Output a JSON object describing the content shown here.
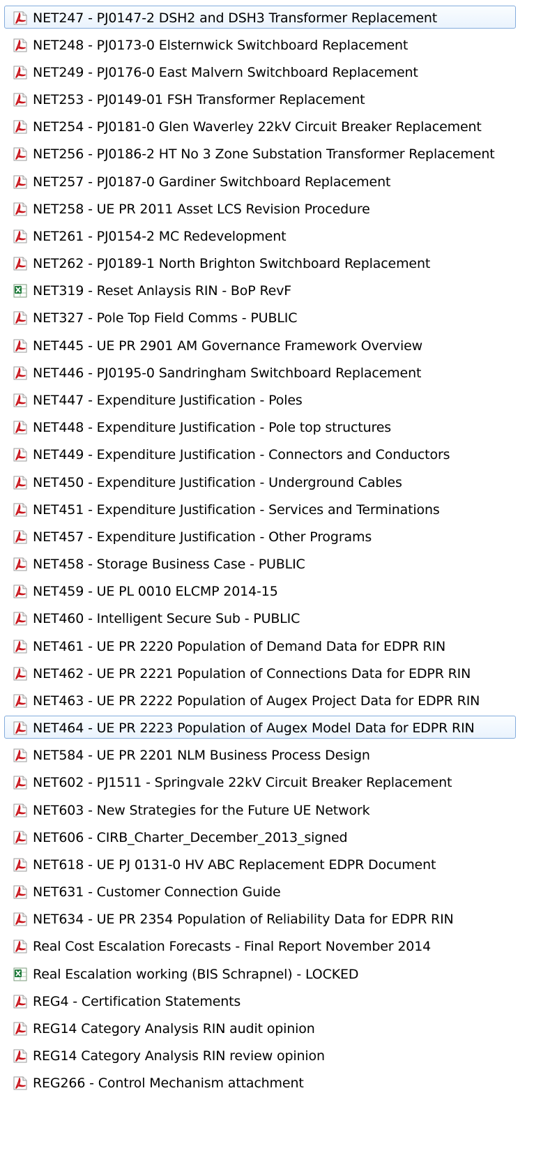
{
  "colors": {
    "pdf_icon": "#c8161d",
    "excel_icon": "#1d7a3a",
    "highlight_border": "#84acdd",
    "highlight_fill": "#eaf3fd"
  },
  "files": [
    {
      "name": "NET247 - PJ0147-2 DSH2 and DSH3 Transformer Replacement",
      "icon": "pdf-icon",
      "highlighted": true
    },
    {
      "name": "NET248 - PJ0173-0 Elsternwick Switchboard Replacement",
      "icon": "pdf-icon",
      "highlighted": false
    },
    {
      "name": "NET249 - PJ0176-0 East Malvern Switchboard Replacement",
      "icon": "pdf-icon",
      "highlighted": false
    },
    {
      "name": "NET253 - PJ0149-01 FSH Transformer Replacement",
      "icon": "pdf-icon",
      "highlighted": false
    },
    {
      "name": "NET254 - PJ0181-0 Glen Waverley 22kV Circuit Breaker Replacement",
      "icon": "pdf-icon",
      "highlighted": false
    },
    {
      "name": "NET256 - PJ0186-2 HT No 3 Zone Substation Transformer Replacement",
      "icon": "pdf-icon",
      "highlighted": false
    },
    {
      "name": "NET257 - PJ0187-0 Gardiner Switchboard Replacement",
      "icon": "pdf-icon",
      "highlighted": false
    },
    {
      "name": "NET258 - UE PR 2011 Asset LCS Revision Procedure",
      "icon": "pdf-icon",
      "highlighted": false
    },
    {
      "name": "NET261 - PJ0154-2 MC Redevelopment",
      "icon": "pdf-icon",
      "highlighted": false
    },
    {
      "name": "NET262 - PJ0189-1 North Brighton Switchboard Replacement",
      "icon": "pdf-icon",
      "highlighted": false
    },
    {
      "name": "NET319 - Reset Anlaysis RIN - BoP RevF",
      "icon": "excel-icon",
      "highlighted": false
    },
    {
      "name": "NET327 - Pole Top Field Comms - PUBLIC",
      "icon": "pdf-icon",
      "highlighted": false
    },
    {
      "name": "NET445 - UE PR 2901 AM Governance Framework Overview",
      "icon": "pdf-icon",
      "highlighted": false
    },
    {
      "name": "NET446 - PJ0195-0 Sandringham Switchboard Replacement",
      "icon": "pdf-icon",
      "highlighted": false
    },
    {
      "name": "NET447 - Expenditure Justification - Poles",
      "icon": "pdf-icon",
      "highlighted": false
    },
    {
      "name": "NET448 - Expenditure Justification - Pole top structures",
      "icon": "pdf-icon",
      "highlighted": false
    },
    {
      "name": "NET449 - Expenditure Justification - Connectors and Conductors",
      "icon": "pdf-icon",
      "highlighted": false
    },
    {
      "name": "NET450 - Expenditure Justification - Underground Cables",
      "icon": "pdf-icon",
      "highlighted": false
    },
    {
      "name": "NET451 - Expenditure Justification - Services and Terminations",
      "icon": "pdf-icon",
      "highlighted": false
    },
    {
      "name": "NET457 - Expenditure Justification - Other Programs",
      "icon": "pdf-icon",
      "highlighted": false
    },
    {
      "name": "NET458 - Storage Business Case - PUBLIC",
      "icon": "pdf-icon",
      "highlighted": false
    },
    {
      "name": "NET459 - UE PL 0010 ELCMP 2014-15",
      "icon": "pdf-icon",
      "highlighted": false
    },
    {
      "name": "NET460 - Intelligent Secure Sub - PUBLIC",
      "icon": "pdf-icon",
      "highlighted": false
    },
    {
      "name": "NET461 - UE PR 2220 Population of Demand Data for EDPR RIN",
      "icon": "pdf-icon",
      "highlighted": false
    },
    {
      "name": "NET462 - UE PR 2221 Population of Connections Data for EDPR RIN",
      "icon": "pdf-icon",
      "highlighted": false
    },
    {
      "name": "NET463 - UE PR 2222 Population of Augex Project Data for EDPR RIN",
      "icon": "pdf-icon",
      "highlighted": false
    },
    {
      "name": "NET464 - UE PR 2223 Population of Augex Model Data for EDPR RIN",
      "icon": "pdf-icon",
      "highlighted": true
    },
    {
      "name": "NET584 - UE PR 2201 NLM Business Process Design",
      "icon": "pdf-icon",
      "highlighted": false
    },
    {
      "name": "NET602 - PJ1511 - Springvale 22kV Circuit Breaker Replacement",
      "icon": "pdf-icon",
      "highlighted": false
    },
    {
      "name": "NET603 - New Strategies for the Future UE Network",
      "icon": "pdf-icon",
      "highlighted": false
    },
    {
      "name": "NET606 - CIRB_Charter_December_2013_signed",
      "icon": "pdf-icon",
      "highlighted": false
    },
    {
      "name": "NET618 - UE PJ 0131-0 HV ABC Replacement EDPR Document",
      "icon": "pdf-icon",
      "highlighted": false
    },
    {
      "name": "NET631 - Customer Connection Guide",
      "icon": "pdf-icon",
      "highlighted": false
    },
    {
      "name": "NET634 - UE PR 2354 Population of Reliability Data for EDPR RIN",
      "icon": "pdf-icon",
      "highlighted": false
    },
    {
      "name": "Real Cost Escalation Forecasts - Final Report November 2014",
      "icon": "pdf-icon",
      "highlighted": false
    },
    {
      "name": "Real Escalation working (BIS Schrapnel) - LOCKED",
      "icon": "excel-icon",
      "highlighted": false
    },
    {
      "name": "REG4 - Certification Statements",
      "icon": "pdf-icon",
      "highlighted": false
    },
    {
      "name": "REG14 Category Analysis RIN audit opinion",
      "icon": "pdf-icon",
      "highlighted": false
    },
    {
      "name": "REG14 Category Analysis RIN review opinion",
      "icon": "pdf-icon",
      "highlighted": false
    },
    {
      "name": "REG266 - Control Mechanism attachment",
      "icon": "pdf-icon",
      "highlighted": false
    }
  ]
}
